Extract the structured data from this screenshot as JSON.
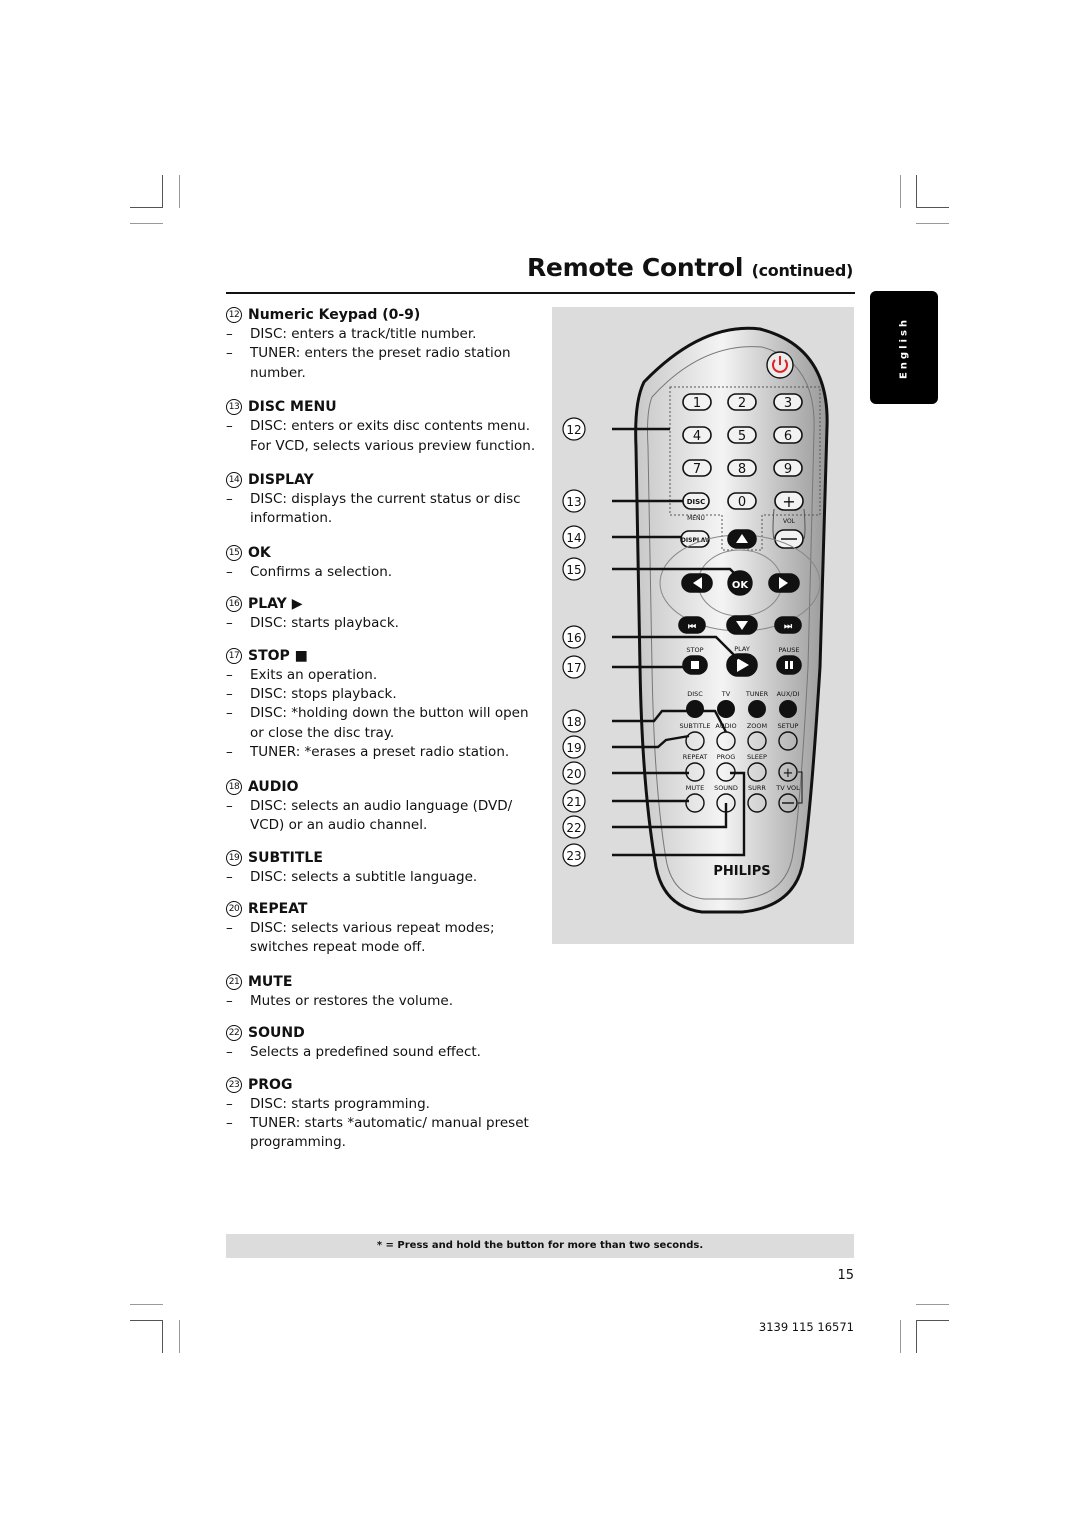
{
  "header": {
    "title": "Remote Control",
    "continued": "(continued)"
  },
  "language_tab": "English",
  "items": [
    {
      "number": "12",
      "title": "Numeric Keypad (0-9)",
      "bullets": [
        "DISC: enters a track/title number.",
        "TUNER: enters the preset radio station number."
      ]
    },
    {
      "number": "13",
      "title": "DISC MENU",
      "bullets": [
        "DISC: enters or exits disc contents menu. For VCD, selects various preview function."
      ]
    },
    {
      "number": "14",
      "title": "DISPLAY",
      "bullets": [
        "DISC: displays the current status or disc information."
      ]
    },
    {
      "number": "15",
      "title": "OK",
      "bullets": [
        "Confirms a selection."
      ]
    },
    {
      "number": "16",
      "title": "PLAY ▶",
      "bullets": [
        "DISC: starts playback."
      ]
    },
    {
      "number": "17",
      "title": "STOP ■",
      "bullets": [
        "Exits an operation.",
        "DISC: stops playback.",
        "DISC: *holding down the button will open or close the disc tray.",
        "TUNER: *erases a preset radio station."
      ]
    },
    {
      "number": "18",
      "title": "AUDIO",
      "bullets": [
        "DISC: selects an audio language (DVD/ VCD) or an audio channel."
      ]
    },
    {
      "number": "19",
      "title": "SUBTITLE",
      "bullets": [
        "DISC: selects a subtitle language."
      ]
    },
    {
      "number": "20",
      "title": "REPEAT",
      "bullets": [
        "DISC: selects various repeat modes; switches repeat mode off."
      ]
    },
    {
      "number": "21",
      "title": "MUTE",
      "bullets": [
        "Mutes or restores the volume."
      ]
    },
    {
      "number": "22",
      "title": "SOUND",
      "bullets": [
        "Selects a predefined sound effect."
      ]
    },
    {
      "number": "23",
      "title": "PROG",
      "bullets": [
        "DISC: starts programming.",
        "TUNER: starts *automatic/ manual preset programming."
      ]
    }
  ],
  "remote": {
    "brand": "PHILIPS",
    "callouts": [
      "12",
      "13",
      "14",
      "15",
      "16",
      "17",
      "18",
      "19",
      "20",
      "21",
      "22",
      "23"
    ],
    "keypad": [
      "1",
      "2",
      "3",
      "4",
      "5",
      "6",
      "7",
      "8",
      "9",
      "0"
    ],
    "labels": {
      "disc": "DISC",
      "menu": "MENU",
      "display": "DISPLAY",
      "vol": "VOL",
      "ok": "OK",
      "stop": "STOP",
      "play": "PLAY",
      "pause": "PAUSE",
      "source": [
        "DISC",
        "TV",
        "TUNER",
        "AUX/DI"
      ],
      "row1": [
        "SUBTITLE",
        "AUDIO",
        "ZOOM",
        "SETUP"
      ],
      "row2": [
        "REPEAT",
        "PROG",
        "SLEEP"
      ],
      "row3": [
        "MUTE",
        "SOUND",
        "SURR",
        "TV VOL"
      ]
    },
    "colors": {
      "power": "#e02020",
      "body": "#d4d4d4",
      "bg": "#dcdcdc"
    }
  },
  "footnote": "* = Press and hold the button for more than two seconds.",
  "page_number": "15",
  "doc_code": "3139 115 16571"
}
